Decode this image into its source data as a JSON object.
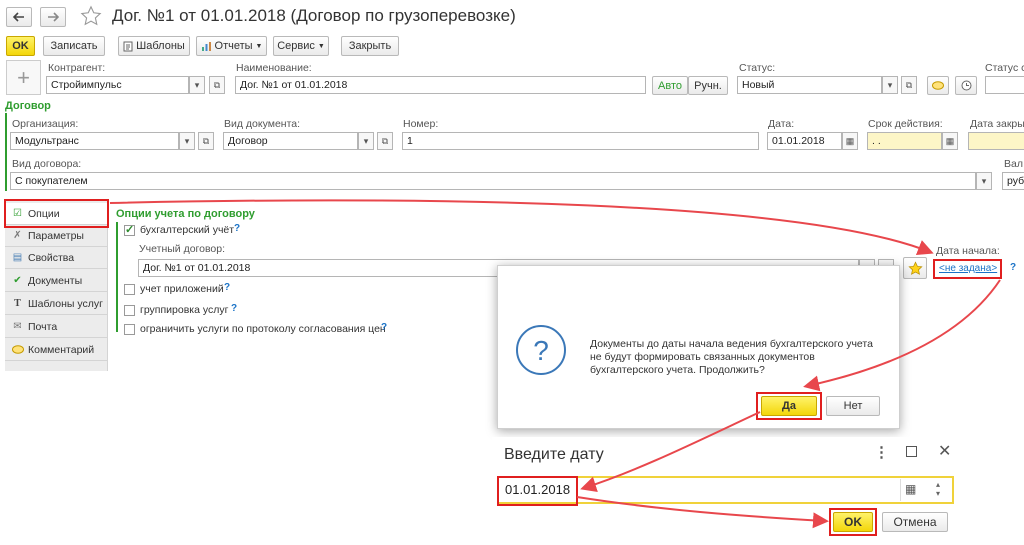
{
  "window": {
    "title": "Дог. №1 от 01.01.2018 (Договор по грузоперевозке)",
    "back_icon": "arrow-left-icon",
    "forward_icon": "arrow-right-icon",
    "favorite_icon": "star-icon"
  },
  "toolbar": {
    "ok": "OK",
    "save": "Записать",
    "templates": "Шаблоны",
    "reports": "Отчеты",
    "service": "Сервис",
    "close": "Закрыть"
  },
  "header": {
    "kontragent_label": "Контрагент:",
    "kontragent_value": "Стройимпульс",
    "name_label": "Наименование:",
    "name_value": "Дог. №1 от 01.01.2018",
    "auto_btn": "Авто",
    "manual_btn": "Ручн.",
    "status_label": "Статус:",
    "status_value": "Новый",
    "status_extra_label": "Статус с"
  },
  "dogovor": {
    "section_title": "Договор",
    "org_label": "Организация:",
    "org_value": "Модультранс",
    "doc_type_label": "Вид документа:",
    "doc_type_value": "Договор",
    "number_label": "Номер:",
    "number_value": "1",
    "date_label": "Дата:",
    "date_value": "01.01.2018",
    "term_label": "Срок действия:",
    "term_value": " .  .",
    "close_date_label": "Дата закры",
    "contract_kind_label": "Вид договора:",
    "contract_kind_value": "С покупателем",
    "currency_label": "Вал",
    "currency_value": "руб."
  },
  "tabs": [
    {
      "label": "Опции",
      "icon": "checklist-icon"
    },
    {
      "label": "Параметры",
      "icon": "tools-icon"
    },
    {
      "label": "Свойства",
      "icon": "table-icon"
    },
    {
      "label": "Документы",
      "icon": "documents-icon"
    },
    {
      "label": "Шаблоны услуг",
      "icon": "text-template-icon"
    },
    {
      "label": "Почта",
      "icon": "mail-icon"
    },
    {
      "label": "Комментарий",
      "icon": "comment-icon"
    }
  ],
  "options": {
    "title": "Опции учета по договору",
    "accounting_label": "бухгалтерский учёт",
    "accounting_checked": true,
    "account_contract_label": "Учетный договор:",
    "account_contract_value": "Дог. №1 от 01.01.2018",
    "start_date_label": "Дата начала:",
    "start_date_link": "<не задана>",
    "attachments_label": "учет приложений",
    "attachments_checked": false,
    "grouping_label": "группировка услуг",
    "grouping_checked": false,
    "limit_label": "ограничить услуги по протоколу согласования цен",
    "limit_checked": false,
    "help": "?"
  },
  "question_dialog": {
    "icon": "question-icon",
    "text_line1": "Документы до даты начала ведения бухгалтерского учета",
    "text_line2": "не будут формировать связанных документов",
    "text_line3": "бухгалтерского учета. Продолжить?",
    "yes": "Да",
    "no": "Нет"
  },
  "date_dialog": {
    "title": "Введите дату",
    "value": "01.01.2018",
    "ok": "OK",
    "cancel": "Отмена"
  },
  "colors": {
    "accent_green": "#2f9d2f",
    "highlight_red": "#e01f1f",
    "button_yellow": "#f6dc1b",
    "link_blue": "#1b73c7"
  }
}
